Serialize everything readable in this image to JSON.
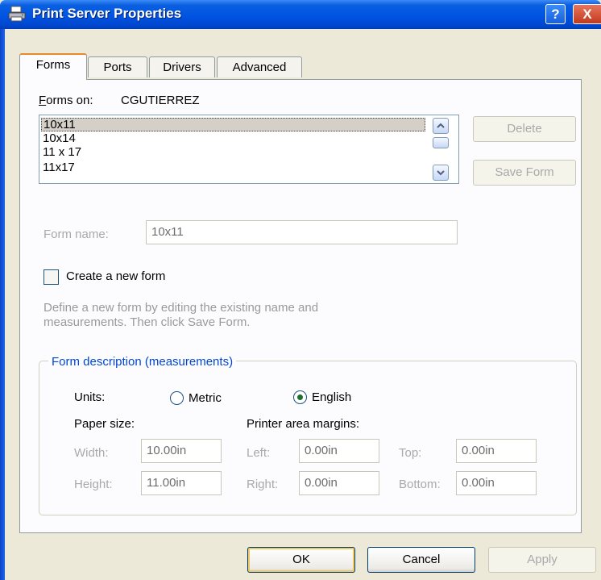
{
  "window": {
    "title": "Print Server Properties",
    "help_glyph": "?",
    "close_glyph": "X"
  },
  "tabs": [
    {
      "label": "Forms",
      "active": true
    },
    {
      "label": "Ports",
      "active": false
    },
    {
      "label": "Drivers",
      "active": false
    },
    {
      "label": "Advanced",
      "active": false
    }
  ],
  "forms": {
    "forms_on_label": "Forms on:",
    "server_name": "CGUTIERREZ",
    "list_items": [
      "10x11",
      "10x14",
      "11 x 17",
      "11x17"
    ],
    "selected_item": "10x11",
    "delete_button": "Delete",
    "save_form_button": "Save Form",
    "form_name_label": "Form name:",
    "form_name_value": "10x11",
    "create_new_form_label": "Create a new form",
    "create_new_form_checked": false,
    "help_text_line1": "Define a new form by editing the existing name and",
    "help_text_line2": "measurements.  Then click Save Form."
  },
  "description": {
    "group_title": "Form description (measurements)",
    "units_label": "Units:",
    "metric_label": "Metric",
    "english_label": "English",
    "selected_unit": "English",
    "paper_size_label": "Paper size:",
    "margins_label": "Printer area margins:",
    "width_label": "Width:",
    "width_value": "10.00in",
    "height_label": "Height:",
    "height_value": "11.00in",
    "left_label": "Left:",
    "left_value": "0.00in",
    "right_label": "Right:",
    "right_value": "0.00in",
    "top_label": "Top:",
    "top_value": "0.00in",
    "bottom_label": "Bottom:",
    "bottom_value": "0.00in"
  },
  "buttons": {
    "ok": "OK",
    "cancel": "Cancel",
    "apply": "Apply"
  },
  "colors": {
    "title_bar": "#0054E3",
    "active_tab_accent": "#E68B2C",
    "group_title": "#0046D5",
    "dialog_bg": "#ECE9D8"
  }
}
